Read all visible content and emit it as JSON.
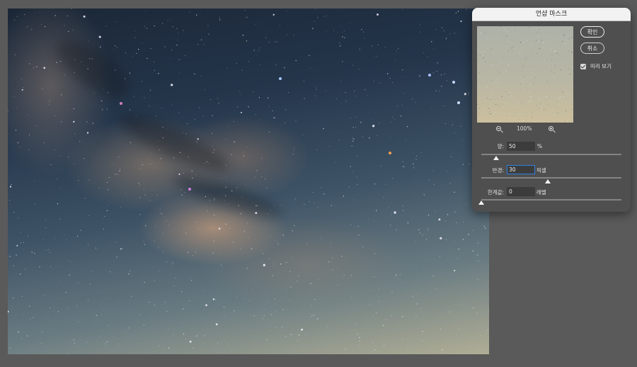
{
  "dialog": {
    "title": "언샵 마스크",
    "ok_label": "확인",
    "cancel_label": "취소",
    "preview_label": "미리 보기",
    "preview_checked": true,
    "zoom_level": "100%",
    "zoom_out_icon": "zoom-out-icon",
    "zoom_in_icon": "zoom-in-icon",
    "fields": {
      "amount": {
        "label": "양:",
        "value": "50",
        "unit": "%",
        "slider_fraction": 0.105
      },
      "radius": {
        "label": "반경:",
        "value": "30",
        "unit": "픽셀",
        "slider_fraction": 0.474
      },
      "threshold": {
        "label": "한계값:",
        "value": "0",
        "unit": "레벨",
        "slider_fraction": 0.0
      }
    }
  }
}
